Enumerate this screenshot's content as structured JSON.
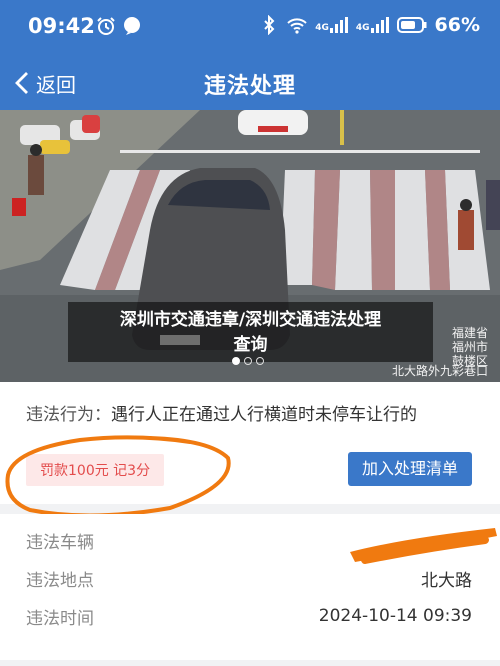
{
  "status_bar": {
    "time": "09:42",
    "battery": "66%",
    "network_labels": [
      "4G",
      "4G"
    ]
  },
  "nav": {
    "back_label": "返回",
    "title": "违法处理"
  },
  "photo": {
    "caption_line1": "深圳市交通违章/深圳交通违法处理",
    "caption_line2": "查询",
    "watermark_lines": [
      "福建省",
      "福州市",
      "鼓楼区"
    ],
    "watermark_location": "北大路外九彩巷口",
    "plate": "闽A·J5H",
    "carousel_count": 3,
    "carousel_active": 1
  },
  "violation": {
    "behavior_label": "违法行为：",
    "behavior_text": "遇行人正在通过人行横道时未停车让行的",
    "fine_text": "罚款100元 记3分",
    "add_button": "加入处理清单"
  },
  "details": {
    "rows": [
      {
        "key": "违法车辆",
        "value": ""
      },
      {
        "key": "违法地点",
        "value": "北大路"
      },
      {
        "key": "违法时间",
        "value": "2024-10-14 09:39"
      }
    ]
  },
  "colors": {
    "brand": "#3a78c9",
    "fine_text": "#e34c4c",
    "annotation": "#f07a10"
  }
}
